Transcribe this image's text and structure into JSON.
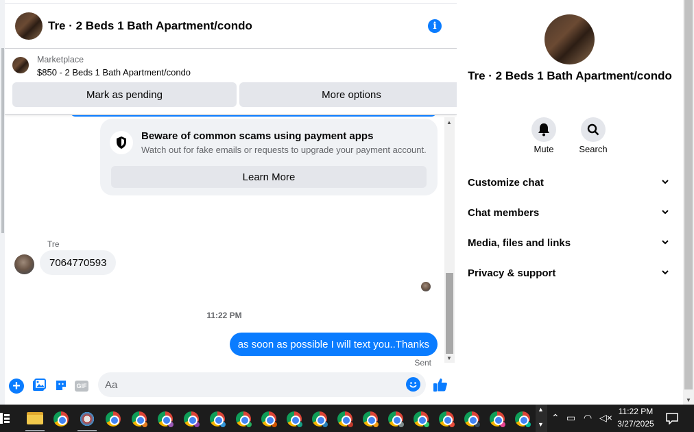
{
  "header": {
    "title": "Tre · 2 Beds 1 Bath Apartment/condo"
  },
  "marketplace": {
    "label": "Marketplace",
    "listing": "$850 - 2 Beds 1 Bath Apartment/condo",
    "pending_button": "Mark as pending",
    "options_button": "More options"
  },
  "scam_notice": {
    "title": "Beware of common scams using payment apps",
    "body": "Watch out for fake emails or requests to upgrade your payment account.",
    "button": "Learn More"
  },
  "messages": {
    "sender": "Tre",
    "incoming": "7064770593",
    "time": "11:22 PM",
    "outgoing": "as soon as possible I will text you..Thanks",
    "status": "Sent"
  },
  "composer": {
    "placeholder": "Aa",
    "gif_label": "GIF"
  },
  "panel": {
    "title": "Tre · 2 Beds 1 Bath Apartment/condo",
    "mute": "Mute",
    "search": "Search",
    "sections": [
      "Customize chat",
      "Chat members",
      "Media, files and links",
      "Privacy & support"
    ]
  },
  "taskbar": {
    "time": "11:22 PM",
    "date": "3/27/2025"
  },
  "colors": {
    "accent": "#0a7cff",
    "bubble": "#f0f2f5",
    "taskbar": "#1c1c1c"
  }
}
